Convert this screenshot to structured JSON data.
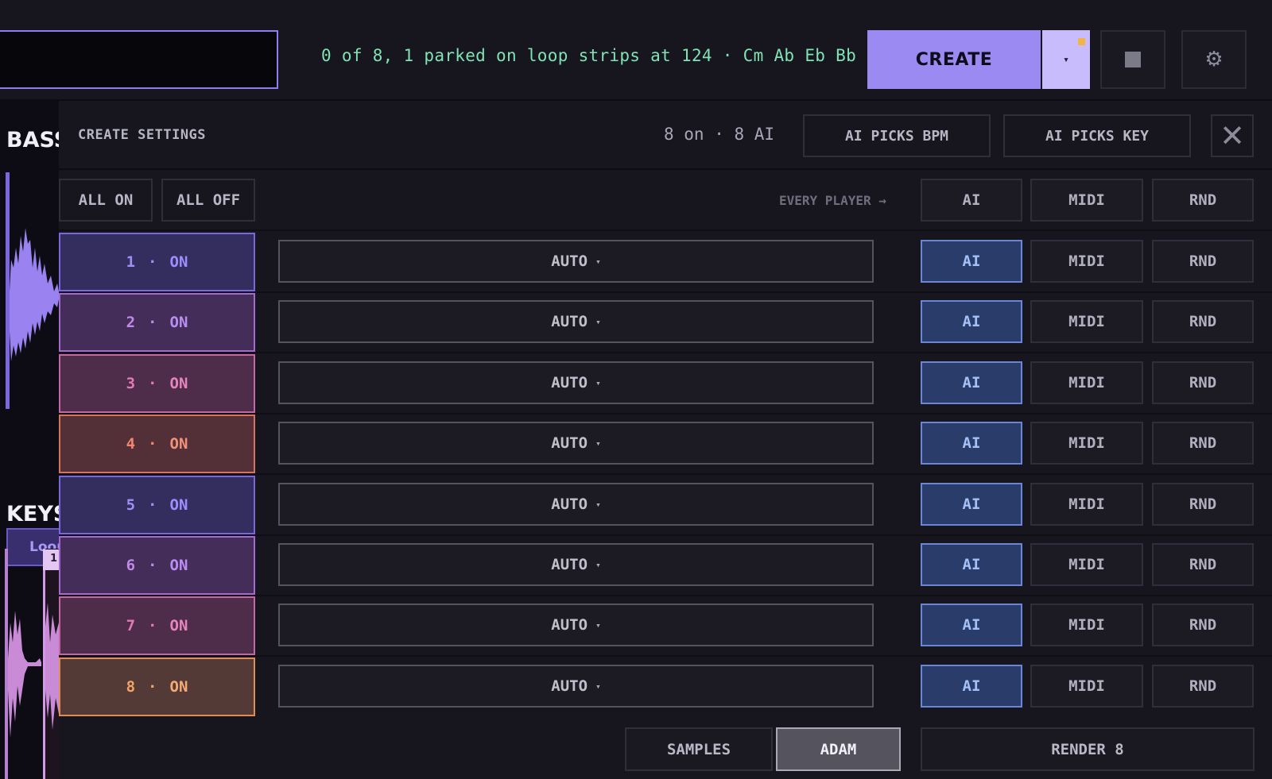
{
  "topbar": {
    "search_value": "",
    "status": "0 of 8, 1 parked on loop strips at 124 · Cm Ab Eb Bb",
    "create_label": "CREATE",
    "dropdown_glyph": "▾",
    "stop_icon": "stop-icon",
    "settings_glyph": "⚙"
  },
  "left_strip": {
    "tracks": [
      {
        "label": "BASS",
        "color": "#9a83f0"
      },
      {
        "label": "KEYS",
        "color": "#c98ad6",
        "badge": "1"
      }
    ],
    "loop_chip": "Loop"
  },
  "settings": {
    "title": "CREATE SETTINGS",
    "count": "8 on · 8 AI",
    "ai_picks_bpm": "AI PICKS BPM",
    "ai_picks_key": "AI PICKS KEY",
    "close_glyph": "✕",
    "all_on": "ALL ON",
    "all_off": "ALL OFF",
    "every_player": "EVERY PLAYER →",
    "global_modes": [
      "AI",
      "MIDI",
      "RND"
    ],
    "players": [
      {
        "num": "1",
        "dot": "·",
        "state": "ON",
        "mode": "AUTO",
        "bg": "#342e5e",
        "border": "#7a67df",
        "num_color": "#a08ff2",
        "state_color": "#9f8cff"
      },
      {
        "num": "2",
        "dot": "·",
        "state": "ON",
        "mode": "AUTO",
        "bg": "#452d5a",
        "border": "#a46ad0",
        "num_color": "#c08ae8",
        "state_color": "#b98df2"
      },
      {
        "num": "3",
        "dot": "·",
        "state": "ON",
        "mode": "AUTO",
        "bg": "#4e2d4a",
        "border": "#c567a5",
        "num_color": "#e27ab4",
        "state_color": "#e685bd"
      },
      {
        "num": "4",
        "dot": "·",
        "state": "ON",
        "mode": "AUTO",
        "bg": "#532f38",
        "border": "#d8735f",
        "num_color": "#f08770",
        "state_color": "#f0917a"
      },
      {
        "num": "5",
        "dot": "·",
        "state": "ON",
        "mode": "AUTO",
        "bg": "#342e5e",
        "border": "#7a67df",
        "num_color": "#a08ff2",
        "state_color": "#9f8cff"
      },
      {
        "num": "6",
        "dot": "·",
        "state": "ON",
        "mode": "AUTO",
        "bg": "#452d5a",
        "border": "#a46ad0",
        "num_color": "#c08ae8",
        "state_color": "#b98df2"
      },
      {
        "num": "7",
        "dot": "·",
        "state": "ON",
        "mode": "AUTO",
        "bg": "#4e2d4a",
        "border": "#c567a5",
        "num_color": "#e27ab4",
        "state_color": "#e685bd"
      },
      {
        "num": "8",
        "dot": "·",
        "state": "ON",
        "mode": "AUTO",
        "bg": "#543a36",
        "border": "#de8d55",
        "num_color": "#f3a36a",
        "state_color": "#f4aa76"
      }
    ],
    "row_modes": [
      "AI",
      "MIDI",
      "RND"
    ],
    "selected_row_mode": "AI",
    "mode_caret": "▾"
  },
  "footer": {
    "samples": "SAMPLES",
    "adam": "ADAM",
    "selected": "ADAM",
    "render": "RENDER 8"
  }
}
